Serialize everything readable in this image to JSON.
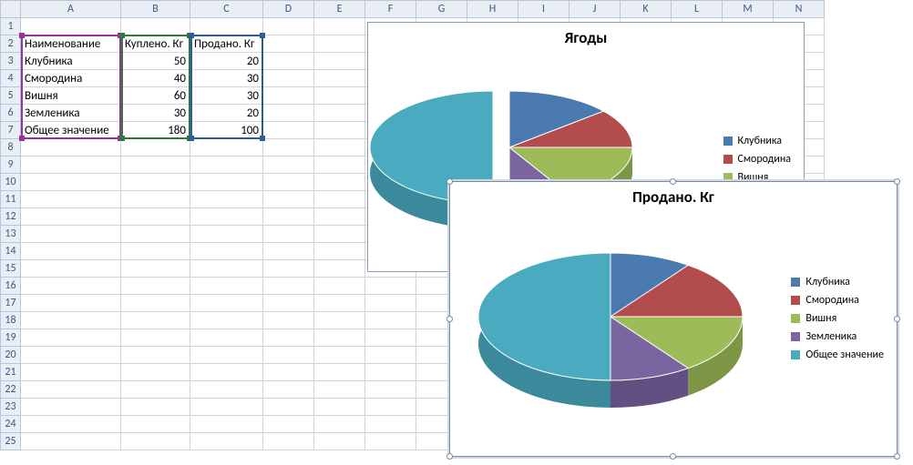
{
  "columns": [
    "A",
    "B",
    "C",
    "D",
    "E",
    "F",
    "G",
    "H",
    "I",
    "J",
    "K",
    "L",
    "M",
    "N"
  ],
  "rows_visible": 25,
  "table": {
    "headers": {
      "name": "Наименование",
      "bought": "Куплено. Кг",
      "sold": "Продано. Кг"
    },
    "rows": [
      {
        "name": "Клубника",
        "bought": 50,
        "sold": 20
      },
      {
        "name": "Смородина",
        "bought": 40,
        "sold": 30
      },
      {
        "name": "Вишня",
        "bought": 60,
        "sold": 30
      },
      {
        "name": "Земленика",
        "bought": 30,
        "sold": 20
      },
      {
        "name": "Общее значение",
        "bought": 180,
        "sold": 100
      }
    ]
  },
  "legend_items": [
    "Клубника",
    "Смородина",
    "Вишня",
    "Земленика",
    "Общее значение"
  ],
  "colors": {
    "series": [
      "#4a7ab0",
      "#b34d4d",
      "#9dbb59",
      "#7a65a0",
      "#4aabc0"
    ]
  },
  "chart1": {
    "title": "Ягоды"
  },
  "chart2": {
    "title": "Продано. Кг"
  },
  "chart_data": [
    {
      "type": "pie",
      "title": "Ягоды",
      "categories": [
        "Клубника",
        "Смородина",
        "Вишня",
        "Земленика",
        "Общее значение"
      ],
      "values": [
        50,
        40,
        60,
        30,
        180
      ],
      "note": "3D pie, category 'Общее значение' slice pulled out",
      "legend_position": "right"
    },
    {
      "type": "pie",
      "title": "Продано. Кг",
      "categories": [
        "Клубника",
        "Смородина",
        "Вишня",
        "Земленика",
        "Общее значение"
      ],
      "values": [
        20,
        30,
        30,
        20,
        100
      ],
      "note": "3D pie",
      "legend_position": "right"
    }
  ]
}
